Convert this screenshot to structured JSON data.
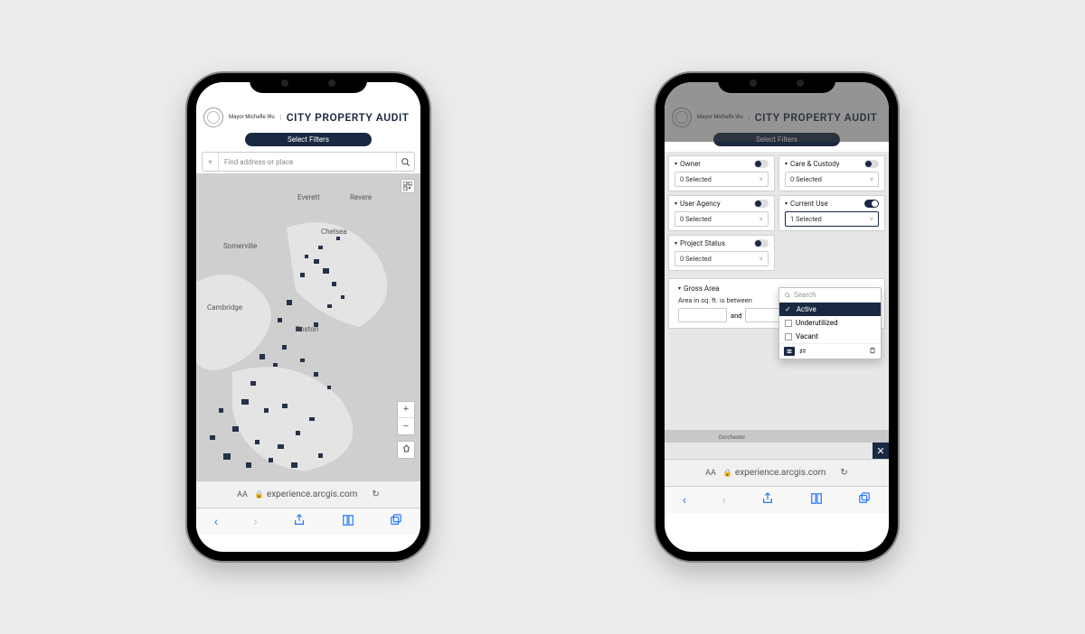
{
  "header": {
    "mayor_line": "Mayor Michelle Wu",
    "title": "CITY PROPERTY AUDIT",
    "select_filters": "Select Filters"
  },
  "search": {
    "placeholder": "Find address or place"
  },
  "map": {
    "labels": [
      "Everett",
      "Revere",
      "Chelsea",
      "Somerville",
      "Cambridge",
      "Boston"
    ],
    "phone2_label": "Dorchester"
  },
  "filters": {
    "owner": {
      "label": "Owner",
      "selected": "0 Selected",
      "toggle": "off"
    },
    "care_custody": {
      "label": "Care & Custody",
      "selected": "0 Selected",
      "toggle": "off"
    },
    "user_agency": {
      "label": "User Agency",
      "selected": "0 Selected",
      "toggle": "off"
    },
    "current_use": {
      "label": "Current Use",
      "selected": "1 Selected",
      "toggle": "on"
    },
    "project_status": {
      "label": "Project Status",
      "selected": "0 Selected",
      "toggle": "off"
    },
    "gross_area": {
      "label": "Gross Area",
      "between_text": "Area in sq. ft. is between",
      "and": "and"
    }
  },
  "dropdown": {
    "search_placeholder": "Search",
    "options": [
      "Active",
      "Underutilized",
      "Vacant"
    ],
    "selected_index": 0
  },
  "safari": {
    "url": "experience.arcgis.com"
  }
}
